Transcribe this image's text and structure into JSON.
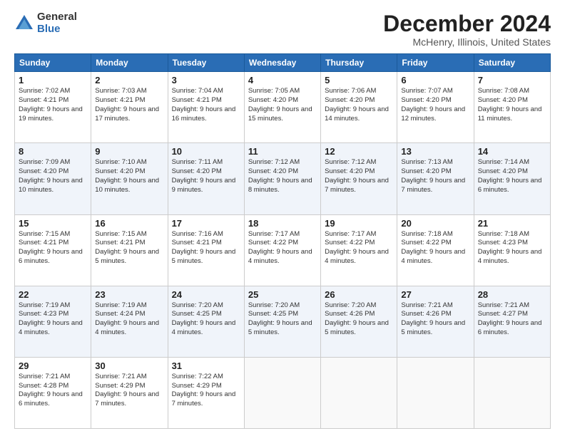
{
  "logo": {
    "general": "General",
    "blue": "Blue"
  },
  "title": "December 2024",
  "location": "McHenry, Illinois, United States",
  "days_of_week": [
    "Sunday",
    "Monday",
    "Tuesday",
    "Wednesday",
    "Thursday",
    "Friday",
    "Saturday"
  ],
  "weeks": [
    [
      {
        "day": "1",
        "sunrise": "7:02 AM",
        "sunset": "4:21 PM",
        "daylight": "9 hours and 19 minutes."
      },
      {
        "day": "2",
        "sunrise": "7:03 AM",
        "sunset": "4:21 PM",
        "daylight": "9 hours and 17 minutes."
      },
      {
        "day": "3",
        "sunrise": "7:04 AM",
        "sunset": "4:21 PM",
        "daylight": "9 hours and 16 minutes."
      },
      {
        "day": "4",
        "sunrise": "7:05 AM",
        "sunset": "4:20 PM",
        "daylight": "9 hours and 15 minutes."
      },
      {
        "day": "5",
        "sunrise": "7:06 AM",
        "sunset": "4:20 PM",
        "daylight": "9 hours and 14 minutes."
      },
      {
        "day": "6",
        "sunrise": "7:07 AM",
        "sunset": "4:20 PM",
        "daylight": "9 hours and 12 minutes."
      },
      {
        "day": "7",
        "sunrise": "7:08 AM",
        "sunset": "4:20 PM",
        "daylight": "9 hours and 11 minutes."
      }
    ],
    [
      {
        "day": "8",
        "sunrise": "7:09 AM",
        "sunset": "4:20 PM",
        "daylight": "9 hours and 10 minutes."
      },
      {
        "day": "9",
        "sunrise": "7:10 AM",
        "sunset": "4:20 PM",
        "daylight": "9 hours and 10 minutes."
      },
      {
        "day": "10",
        "sunrise": "7:11 AM",
        "sunset": "4:20 PM",
        "daylight": "9 hours and 9 minutes."
      },
      {
        "day": "11",
        "sunrise": "7:12 AM",
        "sunset": "4:20 PM",
        "daylight": "9 hours and 8 minutes."
      },
      {
        "day": "12",
        "sunrise": "7:12 AM",
        "sunset": "4:20 PM",
        "daylight": "9 hours and 7 minutes."
      },
      {
        "day": "13",
        "sunrise": "7:13 AM",
        "sunset": "4:20 PM",
        "daylight": "9 hours and 7 minutes."
      },
      {
        "day": "14",
        "sunrise": "7:14 AM",
        "sunset": "4:20 PM",
        "daylight": "9 hours and 6 minutes."
      }
    ],
    [
      {
        "day": "15",
        "sunrise": "7:15 AM",
        "sunset": "4:21 PM",
        "daylight": "9 hours and 6 minutes."
      },
      {
        "day": "16",
        "sunrise": "7:15 AM",
        "sunset": "4:21 PM",
        "daylight": "9 hours and 5 minutes."
      },
      {
        "day": "17",
        "sunrise": "7:16 AM",
        "sunset": "4:21 PM",
        "daylight": "9 hours and 5 minutes."
      },
      {
        "day": "18",
        "sunrise": "7:17 AM",
        "sunset": "4:22 PM",
        "daylight": "9 hours and 4 minutes."
      },
      {
        "day": "19",
        "sunrise": "7:17 AM",
        "sunset": "4:22 PM",
        "daylight": "9 hours and 4 minutes."
      },
      {
        "day": "20",
        "sunrise": "7:18 AM",
        "sunset": "4:22 PM",
        "daylight": "9 hours and 4 minutes."
      },
      {
        "day": "21",
        "sunrise": "7:18 AM",
        "sunset": "4:23 PM",
        "daylight": "9 hours and 4 minutes."
      }
    ],
    [
      {
        "day": "22",
        "sunrise": "7:19 AM",
        "sunset": "4:23 PM",
        "daylight": "9 hours and 4 minutes."
      },
      {
        "day": "23",
        "sunrise": "7:19 AM",
        "sunset": "4:24 PM",
        "daylight": "9 hours and 4 minutes."
      },
      {
        "day": "24",
        "sunrise": "7:20 AM",
        "sunset": "4:25 PM",
        "daylight": "9 hours and 4 minutes."
      },
      {
        "day": "25",
        "sunrise": "7:20 AM",
        "sunset": "4:25 PM",
        "daylight": "9 hours and 5 minutes."
      },
      {
        "day": "26",
        "sunrise": "7:20 AM",
        "sunset": "4:26 PM",
        "daylight": "9 hours and 5 minutes."
      },
      {
        "day": "27",
        "sunrise": "7:21 AM",
        "sunset": "4:26 PM",
        "daylight": "9 hours and 5 minutes."
      },
      {
        "day": "28",
        "sunrise": "7:21 AM",
        "sunset": "4:27 PM",
        "daylight": "9 hours and 6 minutes."
      }
    ],
    [
      {
        "day": "29",
        "sunrise": "7:21 AM",
        "sunset": "4:28 PM",
        "daylight": "9 hours and 6 minutes."
      },
      {
        "day": "30",
        "sunrise": "7:21 AM",
        "sunset": "4:29 PM",
        "daylight": "9 hours and 7 minutes."
      },
      {
        "day": "31",
        "sunrise": "7:22 AM",
        "sunset": "4:29 PM",
        "daylight": "9 hours and 7 minutes."
      },
      null,
      null,
      null,
      null
    ]
  ]
}
